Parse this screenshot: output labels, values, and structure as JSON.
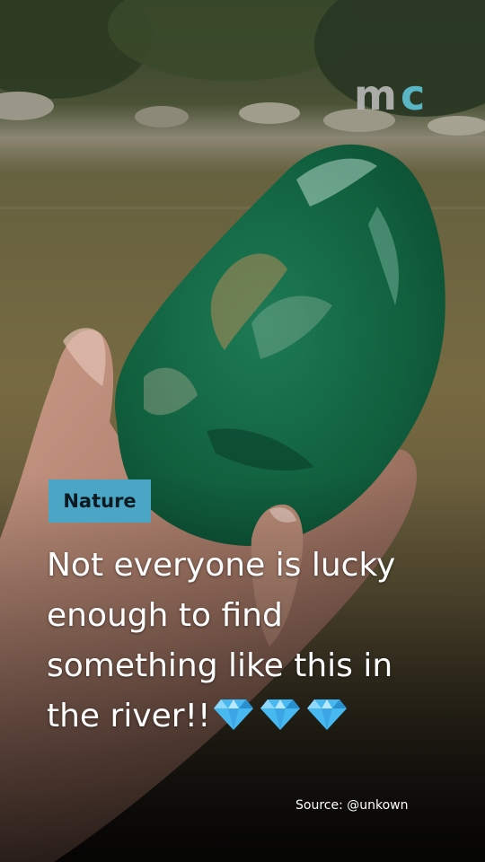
{
  "watermark": {
    "logo_text": "mc",
    "icon_name": "mc-logo-icon"
  },
  "post": {
    "tag_label": "Nature",
    "headline_lines": [
      " Not everyone is lucky",
      "enough to find",
      "something like this in",
      "the river!!"
    ],
    "emoji_icons": [
      "gem-stone-icon",
      "gem-stone-icon",
      "gem-stone-icon"
    ],
    "source_text": "Source: @unkown"
  },
  "colors": {
    "tag_background": "#4aa6c4",
    "logo_m": "#b9b9b9",
    "logo_c": "#5fc3d6",
    "headline_text": "#ffffff",
    "gem": "#48b9f0"
  }
}
